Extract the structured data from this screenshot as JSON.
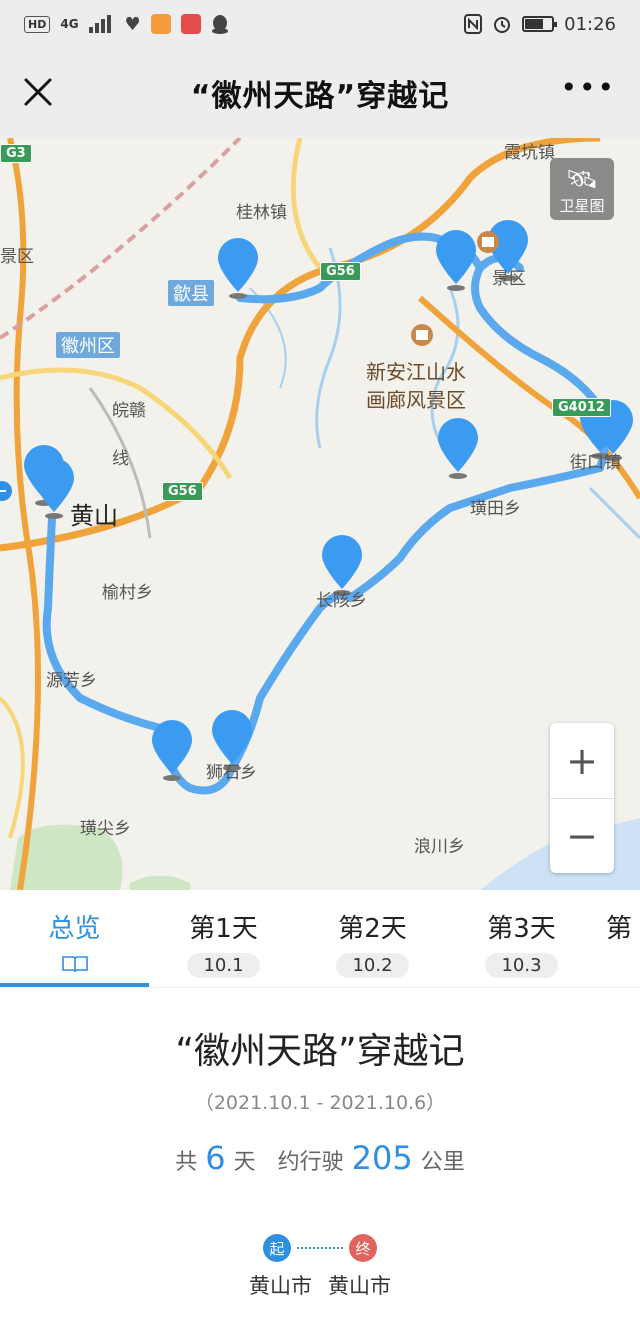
{
  "status_bar": {
    "hd": "HD",
    "network": "4G",
    "time": "01:26"
  },
  "nav": {
    "title": "“徽州天路”穿越记"
  },
  "map": {
    "satellite_label": "卫星图",
    "labels": {
      "jinxian": "歙县",
      "huizhou": "徽州区",
      "huangshan": "黄山",
      "xiakeng": "霞坑镇",
      "guilin": "桂林镇",
      "scenic_left": "景区",
      "scenic_right": "景区",
      "xinanjiang": "新安江山水",
      "hualang": "画廊风景区",
      "wangan": "皖赣",
      "xian": "线",
      "yucun": "榆村乡",
      "yuanfang": "源芳乡",
      "shishi": "狮石乡",
      "changhai": "长陔乡",
      "huangtian": "璜田乡",
      "jiekou": "街口镇",
      "huangjian": "璜尖乡",
      "langchuan": "浪川乡"
    },
    "roads": {
      "g3": "G3",
      "g56a": "G56",
      "g56b": "G56",
      "g4012": "G4012"
    },
    "zoom_in": "+",
    "zoom_out": "−"
  },
  "tabs": [
    {
      "label": "总览",
      "sub": ""
    },
    {
      "label": "第1天",
      "sub": "10.1"
    },
    {
      "label": "第2天",
      "sub": "10.2"
    },
    {
      "label": "第3天",
      "sub": "10.3"
    },
    {
      "label": "第",
      "sub": ""
    }
  ],
  "summary": {
    "title": "“徽州天路”穿越记",
    "dates": "（2021.10.1 - 2021.10.6）",
    "total_prefix": "共",
    "days": "6",
    "days_unit": "天",
    "distance_prefix": "约行驶",
    "distance": "205",
    "distance_unit": "公里",
    "start_marker": "起",
    "end_marker": "终",
    "start_city": "黄山市",
    "end_city": "黄山市"
  },
  "colors": {
    "accent": "#2f8fe0",
    "route": "#5aa8ee",
    "end_marker": "#e0645e"
  }
}
